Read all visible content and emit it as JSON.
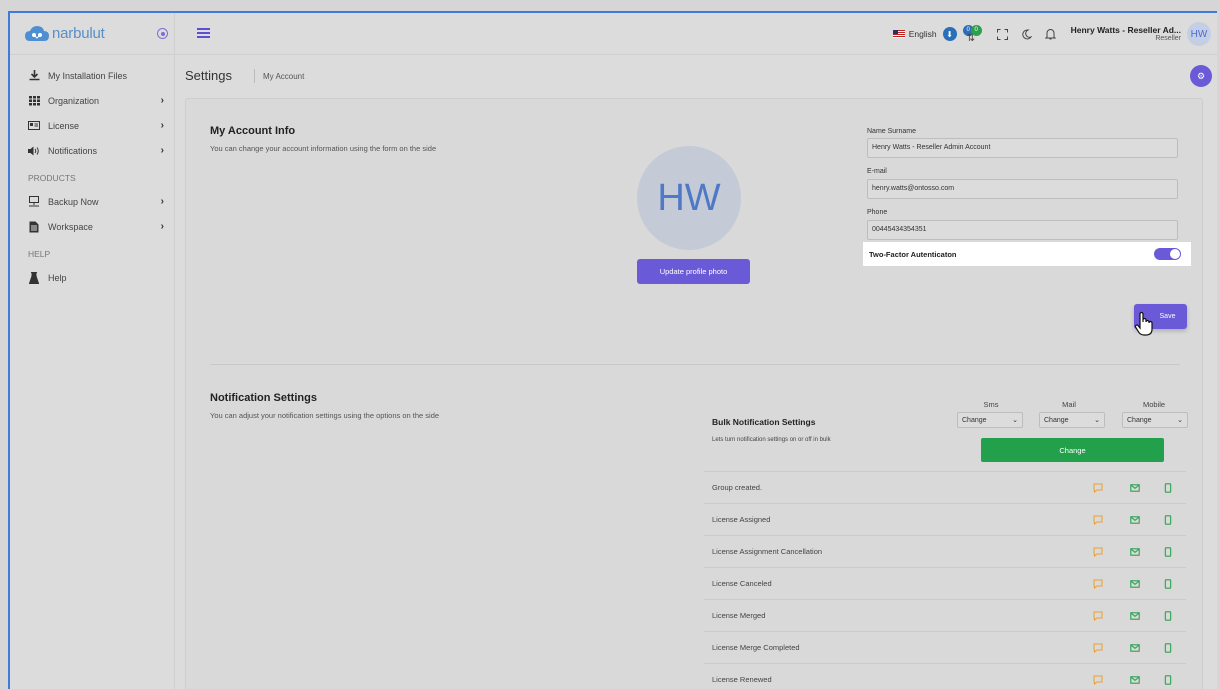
{
  "brand": {
    "name": "narbulut"
  },
  "sidebar": {
    "items": [
      {
        "label": "My Installation Files",
        "icon": "download-icon",
        "caret": false
      },
      {
        "label": "Organization",
        "icon": "grid-icon",
        "caret": true
      },
      {
        "label": "License",
        "icon": "id-card-icon",
        "caret": true
      },
      {
        "label": "Notifications",
        "icon": "speaker-icon",
        "caret": true
      }
    ],
    "products_heading": "PRODUCTS",
    "product_items": [
      {
        "label": "Backup Now",
        "icon": "computer-icon",
        "caret": true
      },
      {
        "label": "Workspace",
        "icon": "document-icon",
        "caret": true
      }
    ],
    "help_heading": "HELP",
    "help_items": [
      {
        "label": "Help",
        "icon": "flask-icon"
      }
    ],
    "caret": "›"
  },
  "topbar": {
    "language": "English",
    "badge_1": "0",
    "badge_2": "0",
    "user_name": "Henry Watts - Reseller Ad...",
    "user_role": "Reseller",
    "avatar_initials": "HW"
  },
  "breadcrumb": {
    "title": "Settings",
    "sub": "My Account"
  },
  "account": {
    "title": "My Account Info",
    "description": "You can change your account information using the form on the side",
    "avatar_initials": "HW",
    "update_photo_label": "Update profile photo",
    "name_label": "Name Surname",
    "name_value": "Henry Watts - Reseller Admin Account",
    "email_label": "E-mail",
    "email_value": "henry.watts@ontosso.com",
    "phone_label": "Phone",
    "phone_value": "00445434354351",
    "tfa_label": "Two-Factor Autenticaton",
    "tfa_enabled": true,
    "save_label": "Save"
  },
  "notifications": {
    "title": "Notification Settings",
    "description": "You can adjust your notification settings using the options on the side",
    "bulk_title": "Bulk Notification Settings",
    "bulk_desc": "Lets turn notification settings on or off in bulk",
    "columns": [
      "Sms",
      "Mail",
      "Mobile"
    ],
    "select_value": "Change",
    "change_label": "Change",
    "rows": [
      "Group created.",
      "License Assigned",
      "License Assignment Cancellation",
      "License Canceled",
      "License Merged",
      "License Merge Completed",
      "License Renewed"
    ]
  },
  "colors": {
    "accent": "#6a5ad8",
    "success": "#22a04b",
    "sms": "#e8a33d",
    "mail": "#2ba24a",
    "mobile": "#2ba24a"
  }
}
